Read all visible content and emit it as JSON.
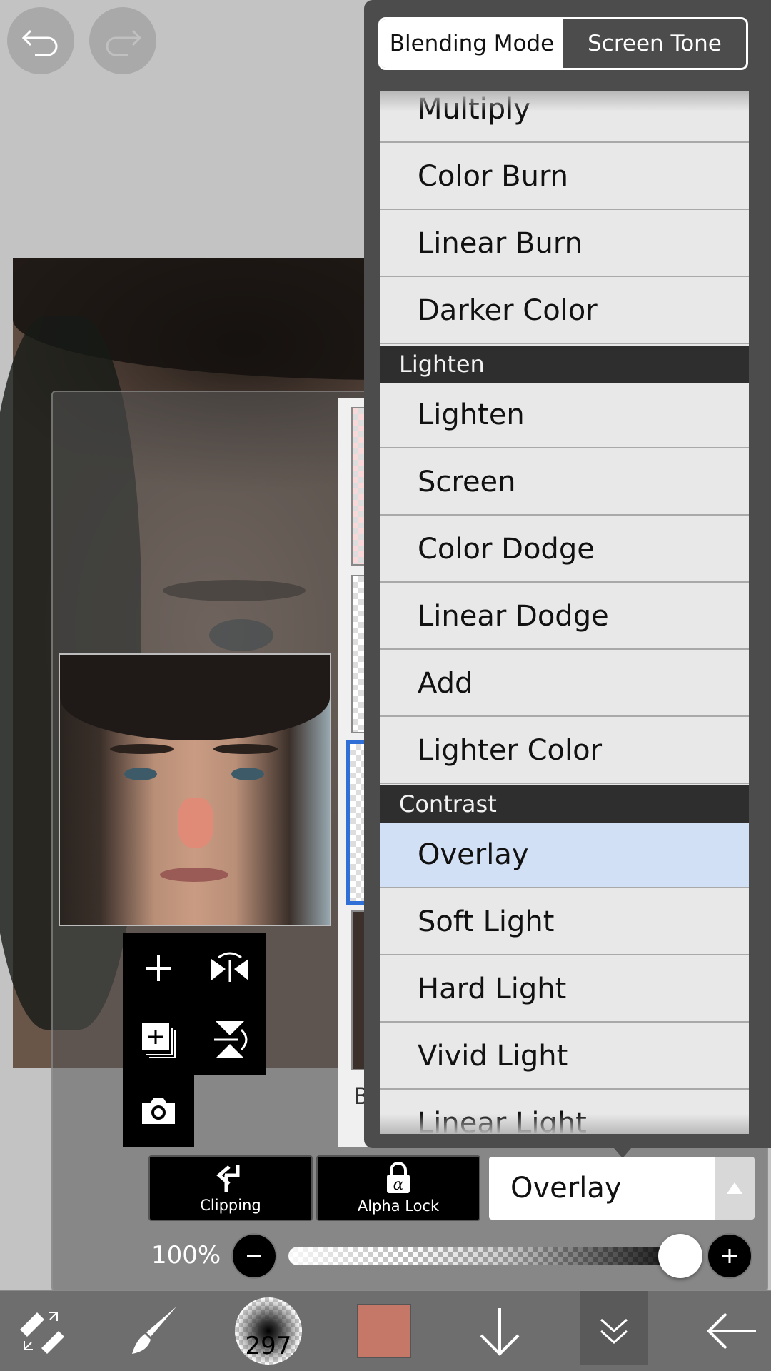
{
  "segmented_control": {
    "left": "Blending Mode",
    "right": "Screen Tone"
  },
  "blend_modes": [
    {
      "type": "item",
      "label": "Multiply"
    },
    {
      "type": "item",
      "label": "Color Burn"
    },
    {
      "type": "item",
      "label": "Linear Burn"
    },
    {
      "type": "item",
      "label": "Darker Color"
    },
    {
      "type": "header",
      "label": "Lighten"
    },
    {
      "type": "item",
      "label": "Lighten"
    },
    {
      "type": "item",
      "label": "Screen"
    },
    {
      "type": "item",
      "label": "Color Dodge"
    },
    {
      "type": "item",
      "label": "Linear Dodge"
    },
    {
      "type": "item",
      "label": "Add"
    },
    {
      "type": "item",
      "label": "Lighter Color"
    },
    {
      "type": "header",
      "label": "Contrast"
    },
    {
      "type": "item",
      "label": "Overlay",
      "selected": true
    },
    {
      "type": "item",
      "label": "Soft Light"
    },
    {
      "type": "item",
      "label": "Hard Light"
    },
    {
      "type": "item",
      "label": "Vivid Light"
    },
    {
      "type": "item",
      "label": "Linear Light"
    }
  ],
  "layer_controls": {
    "clipping_label": "Clipping",
    "alpha_lock_label": "Alpha Lock",
    "blend_mode_value": "Overlay",
    "partial_layer_label": "Ba"
  },
  "opacity": {
    "label": "100%",
    "value": 1.0
  },
  "toolbar": {
    "brush_size": "297",
    "current_color": "#c57868"
  },
  "icons": [
    "undo-icon",
    "redo-icon",
    "add-layer-icon",
    "flip-horizontal-icon",
    "copy-layer-icon",
    "flip-vertical-icon",
    "camera-icon",
    "transform-icon",
    "brush-icon",
    "brush-size-icon",
    "color-swatch",
    "layer-down-icon",
    "collapse-icon",
    "back-arrow-icon"
  ],
  "colors": {
    "selected_row": "#d2e0f5",
    "header_bg": "#2e2e2e",
    "panel_bg": "#4c4c4c"
  }
}
